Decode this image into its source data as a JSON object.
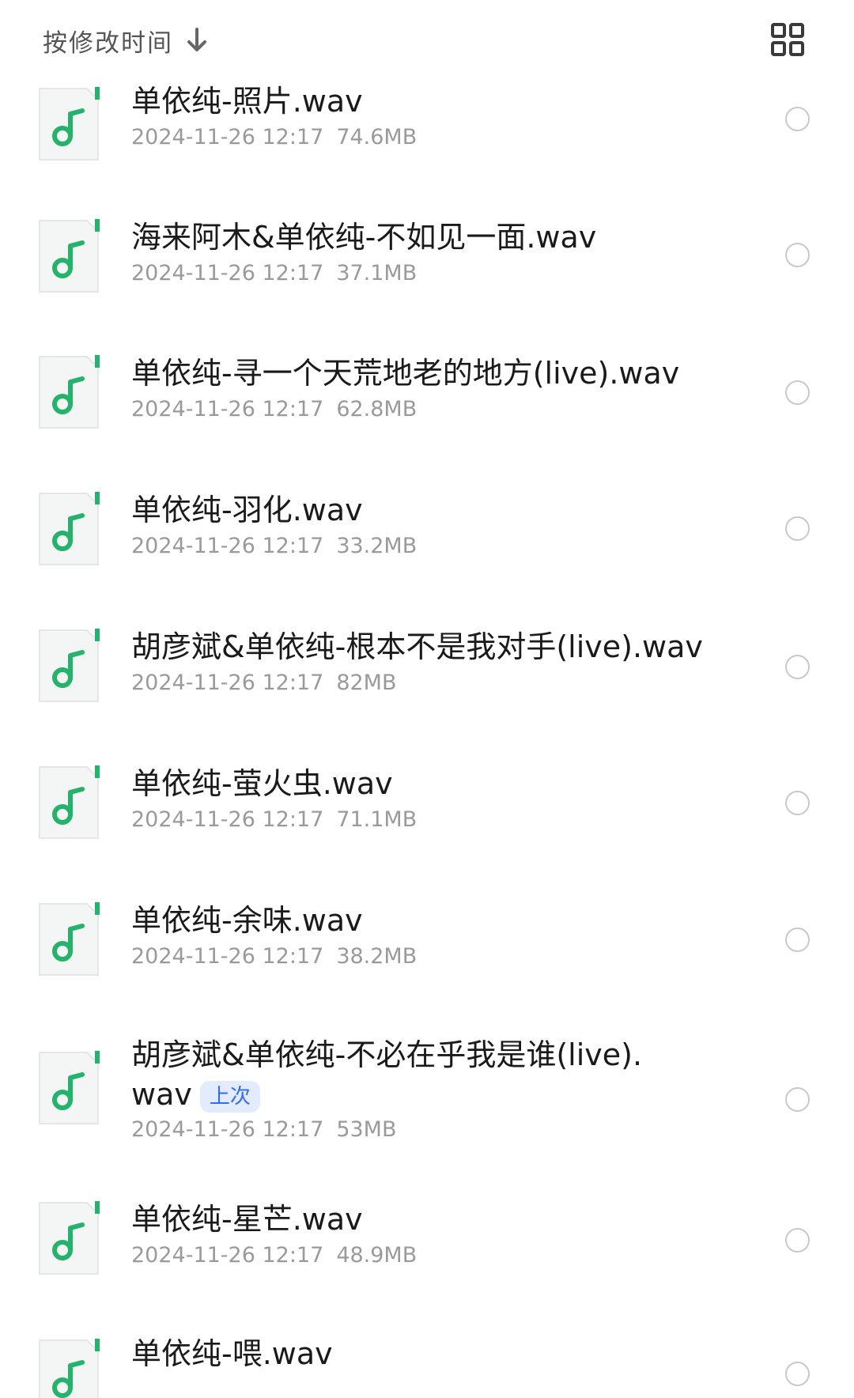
{
  "header": {
    "sort_label": "按修改时间",
    "sort_icon": "arrow-down-icon",
    "view_toggle_icon": "grid-view-icon"
  },
  "colors": {
    "accent_green": "#24b36a",
    "badge_bg": "#e3ecff",
    "badge_text": "#2f6bff",
    "meta_gray": "#9a9a9a"
  },
  "files": [
    {
      "name": "单依纯-照片.wav",
      "date": "2024-11-26 12:17",
      "size": "74.6MB"
    },
    {
      "name": "海来阿木&单依纯-不如见一面.wav",
      "date": "2024-11-26 12:17",
      "size": "37.1MB"
    },
    {
      "name": "单依纯-寻一个天荒地老的地方(live).wav",
      "date": "2024-11-26 12:17",
      "size": "62.8MB"
    },
    {
      "name": "单依纯-羽化.wav",
      "date": "2024-11-26 12:17",
      "size": "33.2MB"
    },
    {
      "name": "胡彦斌&单依纯-根本不是我对手(live).wav",
      "date": "2024-11-26 12:17",
      "size": "82MB"
    },
    {
      "name": "单依纯-萤火虫.wav",
      "date": "2024-11-26 12:17",
      "size": "71.1MB"
    },
    {
      "name": "单依纯-余味.wav",
      "date": "2024-11-26 12:17",
      "size": "38.2MB"
    },
    {
      "name": "胡彦斌&单依纯-不必在乎我是谁(live).wav",
      "badge": "上次",
      "date": "2024-11-26 12:17",
      "size": "53MB"
    },
    {
      "name": "单依纯-星芒.wav",
      "date": "2024-11-26 12:17",
      "size": "48.9MB"
    },
    {
      "name": "单依纯-喂.wav"
    }
  ]
}
